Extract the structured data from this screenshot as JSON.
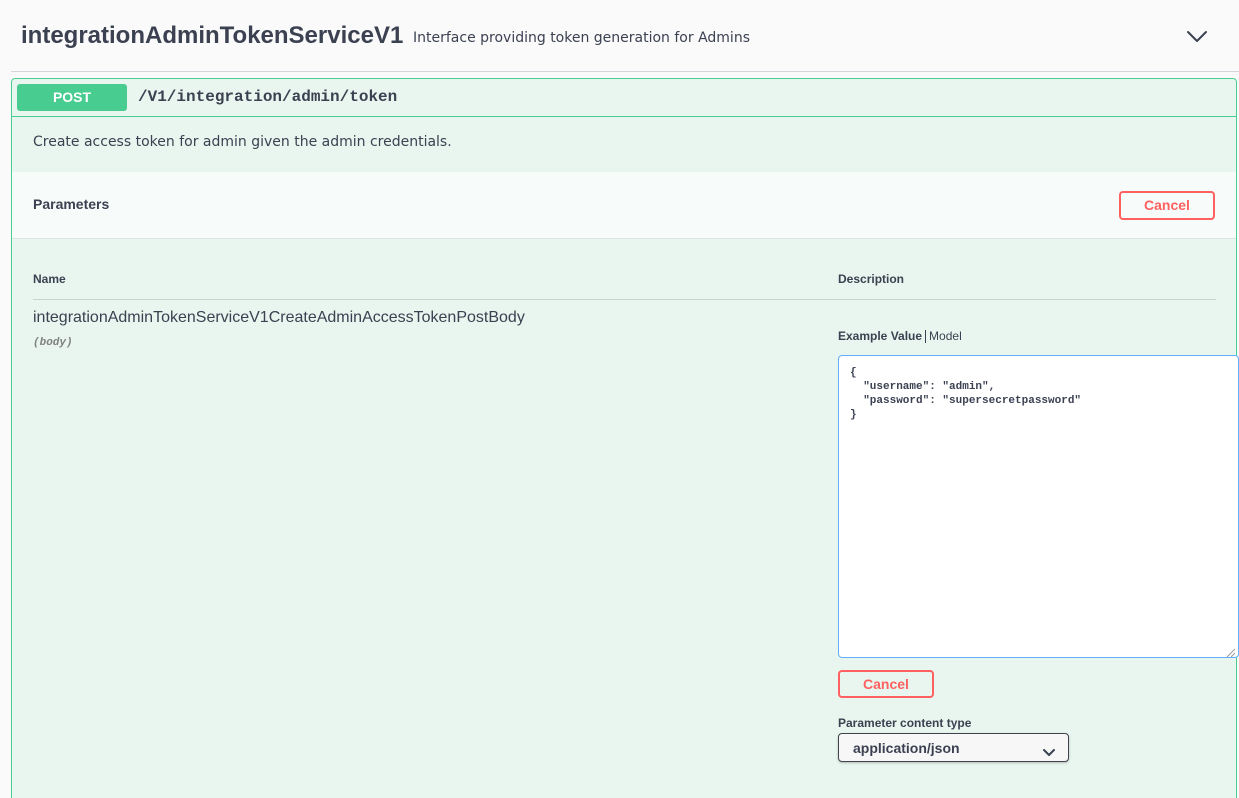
{
  "tag": {
    "title": "integrationAdminTokenServiceV1",
    "description": "Interface providing token generation for Admins",
    "toggle_icon": "chevron-down-icon"
  },
  "operation": {
    "method": "POST",
    "path": "/V1/integration/admin/token",
    "summary": "Create access token for admin given the admin credentials.",
    "accent_color": "#49cc90",
    "background_color": "#e8f6ef"
  },
  "parameters": {
    "title": "Parameters",
    "cancel_label": "Cancel",
    "columns": {
      "name": "Name",
      "description": "Description"
    },
    "items": [
      {
        "name": "integrationAdminTokenServiceV1CreateAdminAccessTokenPostBody",
        "in": "(body)",
        "tabs": {
          "active": "Example Value",
          "inactive": "Model"
        },
        "example_value": "{\n  \"username\": \"admin\",\n  \"password\": \"supersecretpassword\"\n}",
        "cancel_label": "Cancel",
        "content_type_label": "Parameter content type",
        "content_type_value": "application/json"
      }
    ]
  },
  "colors": {
    "cancel": "#ff6060",
    "editor_border": "#61affe",
    "text": "#3b4151"
  }
}
